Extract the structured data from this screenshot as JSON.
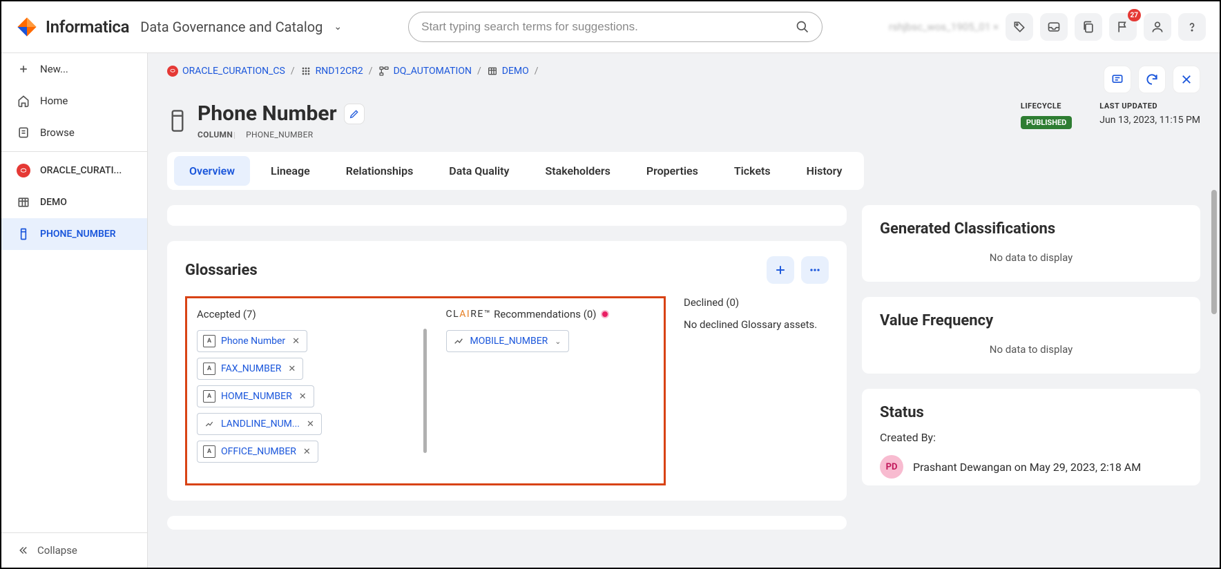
{
  "header": {
    "brand": "Informatica",
    "subbrand": "Data Governance and Catalog",
    "search_placeholder": "Start typing search terms for suggestions.",
    "notification_count": "27",
    "user_blur": "rshjbsc_wos_1905_01 ×"
  },
  "sidebar": {
    "new_label": "New...",
    "home_label": "Home",
    "browse_label": "Browse",
    "nav_items": [
      {
        "label": "ORACLE_CURATI..."
      },
      {
        "label": "DEMO"
      },
      {
        "label": "PHONE_NUMBER"
      }
    ],
    "collapse_label": "Collapse"
  },
  "breadcrumbs": {
    "items": [
      "ORACLE_CURATION_CS",
      "RND12CR2",
      "DQ_AUTOMATION",
      "DEMO"
    ]
  },
  "page": {
    "title": "Phone Number",
    "type_label": "COLUMN",
    "tech_name": "PHONE_NUMBER",
    "lifecycle_label": "LIFECYCLE",
    "lifecycle_value": "PUBLISHED",
    "updated_label": "LAST UPDATED",
    "updated_value": "Jun 13, 2023, 11:15 PM"
  },
  "tabs": [
    "Overview",
    "Lineage",
    "Relationships",
    "Data Quality",
    "Stakeholders",
    "Properties",
    "Tickets",
    "History"
  ],
  "glossaries": {
    "title": "Glossaries",
    "accepted_label": "Accepted (7)",
    "recs_prefix": "CL",
    "recs_ai": "AI",
    "recs_suffix": "RE™",
    "recs_text": " Recommendations (0)",
    "declined_label": "Declined (0)",
    "declined_text": "No declined Glossary assets.",
    "accepted": [
      "Phone Number",
      "FAX_NUMBER",
      "HOME_NUMBER",
      "LANDLINE_NUM...",
      "OFFICE_NUMBER"
    ],
    "recommendations": [
      "MOBILE_NUMBER"
    ]
  },
  "side": {
    "classifications_title": "Generated Classifications",
    "classifications_empty": "No data to display",
    "valuefreq_title": "Value Frequency",
    "valuefreq_empty": "No data to display",
    "status_title": "Status",
    "created_by_label": "Created By:",
    "creator_initials": "PD",
    "creator_text": "Prashant Dewangan on May 29, 2023, 2:18 AM"
  }
}
